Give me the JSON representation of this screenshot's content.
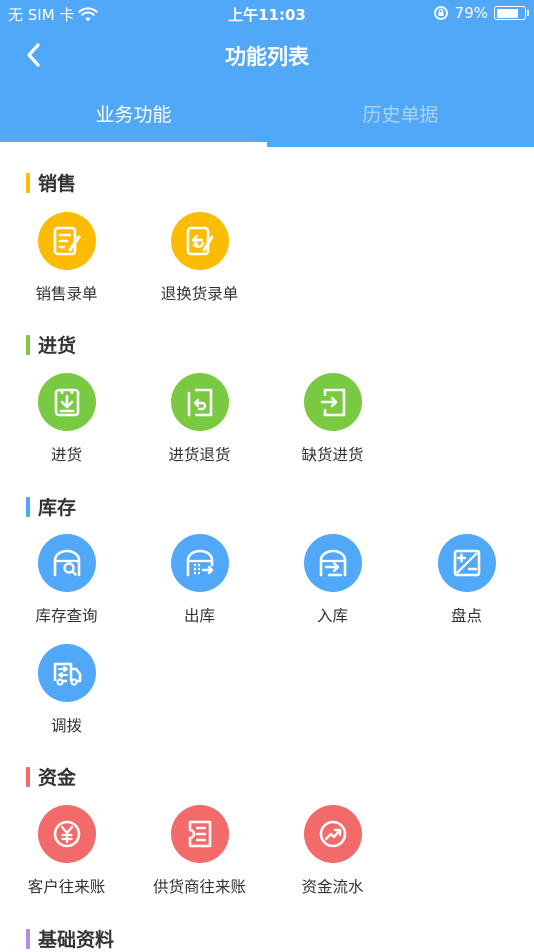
{
  "status_bar": {
    "carrier": "无 SIM 卡",
    "time": "上午11:03",
    "battery": "79%",
    "battery_level": 0.79
  },
  "navbar": {
    "title": "功能列表"
  },
  "tabs": [
    {
      "label": "业务功能",
      "active": true
    },
    {
      "label": "历史单据",
      "active": false
    }
  ],
  "colors": {
    "header": "#52a8f8",
    "sales": "#fcbc05",
    "purchase": "#7ac943",
    "inventory": "#52a8f8",
    "finance": "#f36a6a",
    "basic": "#b98ae6"
  },
  "sections": {
    "sales": {
      "title": "销售",
      "items": [
        {
          "label": "销售录单",
          "icon": "form-edit-icon"
        },
        {
          "label": "退换货录单",
          "icon": "return-edit-icon"
        }
      ]
    },
    "purchase": {
      "title": "进货",
      "items": [
        {
          "label": "进货",
          "icon": "download-box-icon"
        },
        {
          "label": "进货退货",
          "icon": "return-box-icon"
        },
        {
          "label": "缺货进货",
          "icon": "arrow-in-box-icon"
        }
      ]
    },
    "inventory": {
      "title": "库存",
      "items": [
        {
          "label": "库存查询",
          "icon": "warehouse-search-icon"
        },
        {
          "label": "出库",
          "icon": "warehouse-out-icon"
        },
        {
          "label": "入库",
          "icon": "warehouse-in-icon"
        },
        {
          "label": "盘点",
          "icon": "plus-minus-icon"
        },
        {
          "label": "调拨",
          "icon": "truck-transfer-icon"
        }
      ]
    },
    "finance": {
      "title": "资金",
      "items": [
        {
          "label": "客户往来账",
          "icon": "yen-icon"
        },
        {
          "label": "供货商往来账",
          "icon": "receipt-icon"
        },
        {
          "label": "资金流水",
          "icon": "trend-icon"
        }
      ]
    },
    "basic": {
      "title": "基础资料"
    }
  }
}
